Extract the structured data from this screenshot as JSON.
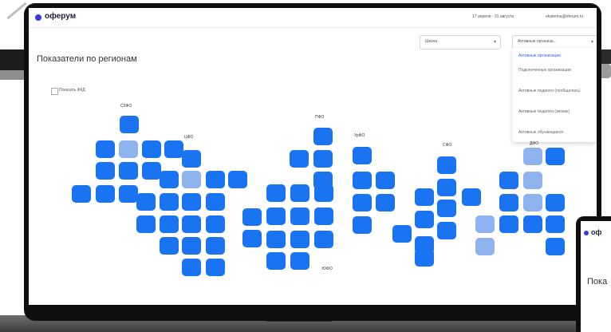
{
  "app": {
    "logo": "оферум",
    "date_range": "17 апреля - 31 августа",
    "user_email": "ekaterina@oferum.ru"
  },
  "page": {
    "title": "Показатели по регионам"
  },
  "filters": {
    "district_select": "Школа",
    "metric_select": "Активные организа...",
    "metric_options": [
      {
        "label": "Активные организации",
        "selected": true
      },
      {
        "label": "Подключенные организации",
        "selected": false
      },
      {
        "label": "Активные педагоги (пообщались)",
        "selected": false
      },
      {
        "label": "Активные педагоги (звонок)",
        "selected": false
      },
      {
        "label": "Активные обучающиеся",
        "selected": false
      }
    ]
  },
  "checkbox": {
    "label": "Показать ФКД",
    "checked": false
  },
  "districts": {
    "szfo": "СЗФО",
    "tsfo": "ЦФО",
    "ufo": "ЮФО",
    "pfo": "ПФО",
    "uralfo": "УрФО",
    "sfo": "СФО",
    "dfo": "ДФО"
  },
  "map": {
    "tile_color": "#1a73f0",
    "tile_color_light": "#8fb3ee"
  },
  "second_device": {
    "logo": "оф",
    "title": "Пока"
  }
}
